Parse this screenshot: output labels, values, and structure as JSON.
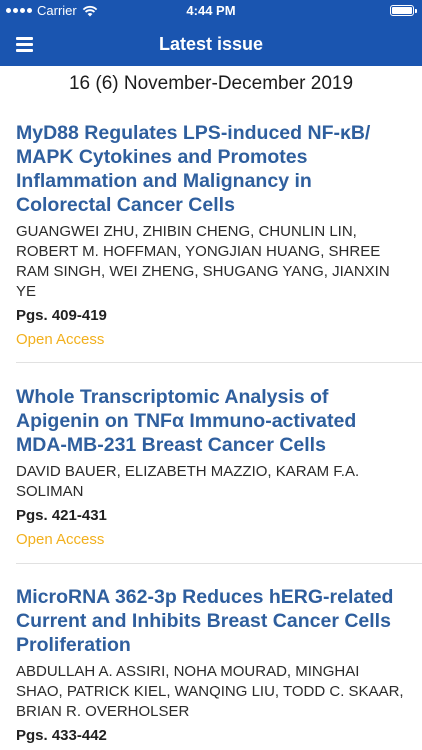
{
  "status_bar": {
    "carrier": "Carrier",
    "time": "4:44 PM"
  },
  "navbar": {
    "title": "Latest issue",
    "menu_icon": "hamburger-menu-icon"
  },
  "issue": {
    "heading": "16 (6) November-December 2019"
  },
  "articles": [
    {
      "title": "MyD88 Regulates LPS-induced NF-κB/ MAPK Cytokines and Promotes Inflammation and Malignancy in Colorectal Cancer Cells",
      "authors": "GUANGWEI ZHU, ZHIBIN CHENG, CHUNLIN LIN, ROBERT M. HOFFMAN, YONGJIAN HUANG, SHREE RAM SINGH, WEI ZHENG, SHUGANG YANG, JIANXIN YE",
      "pages": "Pgs. 409-419",
      "access": "Open Access"
    },
    {
      "title": "Whole Transcriptomic Analysis of Apigenin on TNFα Immuno-activated MDA-MB-231 Breast Cancer Cells",
      "authors": "DAVID BAUER, ELIZABETH MAZZIO, KARAM F.A. SOLIMAN",
      "pages": "Pgs. 421-431",
      "access": "Open Access"
    },
    {
      "title": "MicroRNA 362-3p Reduces hERG-related Current and Inhibits Breast Cancer Cells Proliferation",
      "authors": "ABDULLAH A. ASSIRI, NOHA MOURAD, MINGHAI SHAO, PATRICK KIEL, WANQING LIU, TODD C. SKAAR, BRIAN R. OVERHOLSER",
      "pages": "Pgs. 433-442"
    }
  ],
  "colors": {
    "header_background": "#1a55b0",
    "title_link": "#2f5f9e",
    "open_access": "#f2b01e",
    "divider": "#e1e1e1"
  }
}
